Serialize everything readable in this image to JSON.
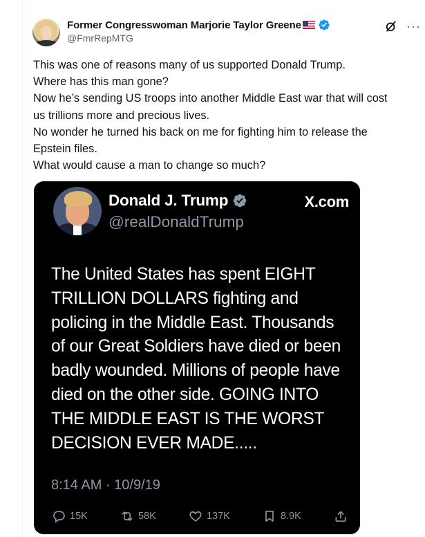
{
  "post": {
    "author_name": "Former Congresswoman Marjorie Taylor Greene",
    "author_handle": "@FmrRepMTG",
    "text_lines": [
      "This was one of reasons many of us supported Donald Trump.",
      "Where has this man gone?",
      "Now he’s sending US troops into another Middle East war that will cost",
      "us trillions more and precious lives.",
      "No wonder he turned his back on me for fighting him to release the",
      "Epstein files.",
      "What would cause a man to change so much?"
    ]
  },
  "embed": {
    "author_name": "Donald J. Trump",
    "author_handle": "@realDonaldTrump",
    "brand": "X.com",
    "text_lines": [
      "The United States has spent EIGHT",
      "TRILLION DOLLARS fighting and",
      "policing in the Middle East. Thousands",
      "of our Great Soldiers have died or been",
      "badly wounded. Millions of people have",
      "died on the other side. GOING INTO",
      "THE MIDDLE EAST IS THE WORST",
      "DECISION EVER MADE....."
    ],
    "timestamp": "8:14 AM · 10/9/19",
    "metrics": {
      "replies": "15K",
      "reposts": "58K",
      "likes": "137K",
      "views": "8.9K"
    }
  },
  "icons": {
    "verified": "verified-badge-icon",
    "flag": "us-flag-icon",
    "grok": "grok-icon",
    "more": "more-icon"
  },
  "colors": {
    "verified_blue": "#1d9bf0",
    "text_primary": "#0f1419",
    "text_secondary": "#536471",
    "embed_bg": "#000000",
    "embed_secondary": "#8b98a5"
  }
}
